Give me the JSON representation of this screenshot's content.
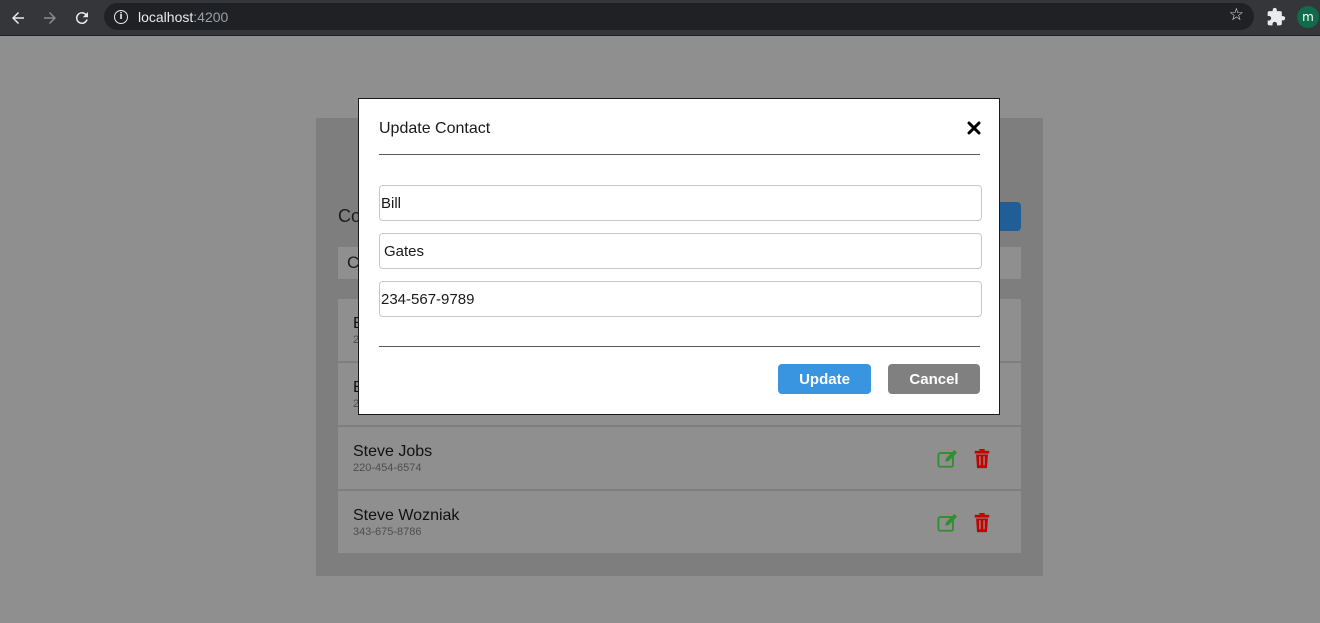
{
  "browser": {
    "url_host": "localhost",
    "url_port": ":4200",
    "profile_initial": "m"
  },
  "app": {
    "heading_partial": "Co",
    "search_partial": "C",
    "accent_color": "#3a95e0",
    "contacts": [
      {
        "name": "B",
        "phone": "2"
      },
      {
        "name": "B",
        "phone": "2"
      },
      {
        "name": "Steve Jobs",
        "phone": "220-454-6574"
      },
      {
        "name": "Steve Wozniak",
        "phone": "343-675-8786"
      }
    ],
    "edit_icon": "edit-icon",
    "delete_icon": "trash-icon",
    "edit_color": "#2f8f2f",
    "delete_color": "#c40000"
  },
  "modal": {
    "title": "Update Contact",
    "close_icon": "close-icon",
    "first_name": "Bill",
    "last_name": "Gates",
    "phone": "234-567-9789",
    "update_label": "Update",
    "cancel_label": "Cancel"
  }
}
